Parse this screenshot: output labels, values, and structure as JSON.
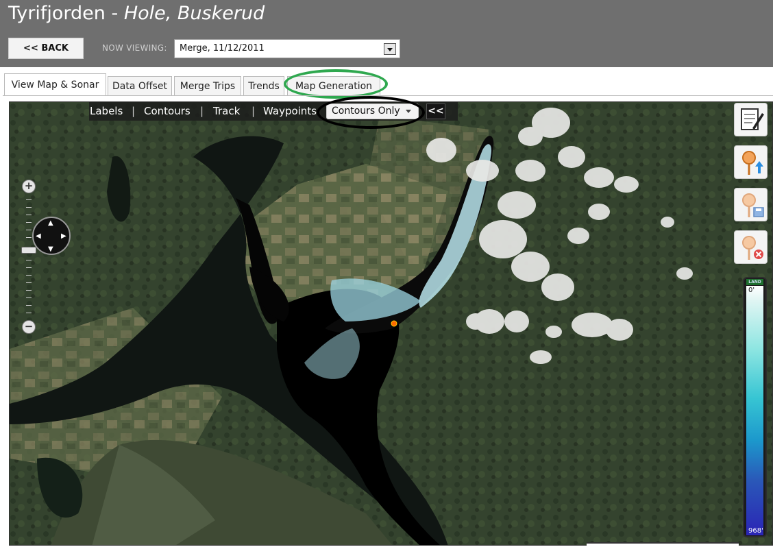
{
  "header": {
    "title_lake": "Tyrifjorden",
    "title_sep": " - ",
    "title_place": "Hole, Buskerud",
    "back_label": "<< BACK",
    "now_viewing_label": "NOW VIEWING:",
    "now_viewing_value": "Merge, 11/12/2011"
  },
  "tabs": [
    {
      "label": "View Map & Sonar"
    },
    {
      "label": "Data Offset"
    },
    {
      "label": "Merge Trips"
    },
    {
      "label": "Trends"
    },
    {
      "label": "Map Generation"
    }
  ],
  "map_toolbar": {
    "labels": "Labels",
    "contours": "Contours",
    "track": "Track",
    "waypoints": "Waypoints",
    "separator": "|",
    "contours_mode": "Contours Only",
    "collapse": "<<"
  },
  "depth_legend": {
    "land_label": "LAND",
    "min": "0'",
    "max": "968'"
  },
  "icons": {
    "pan": "pan-control-icon",
    "zoom_in": "zoom-in-icon",
    "zoom_out": "zoom-out-icon",
    "notepad": "notepad-edit-icon",
    "add_waypoint": "waypoint-upload-icon",
    "save_waypoint": "waypoint-save-icon",
    "delete_waypoint": "waypoint-delete-icon"
  },
  "colors": {
    "header_bg": "#6f6f6f",
    "highlight_green": "#2fa84f",
    "highlight_black": "#000000"
  }
}
